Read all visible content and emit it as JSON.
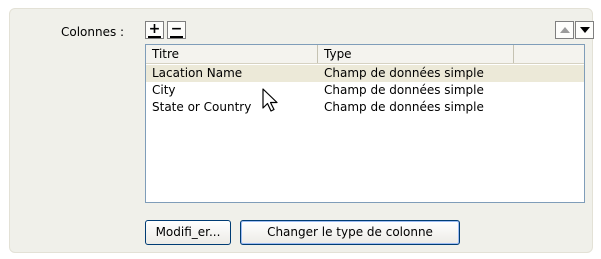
{
  "columns_label": "Colonnes :",
  "toolbar": {
    "add_label": "+",
    "remove_label": "−"
  },
  "table": {
    "headers": [
      "Titre",
      "Type",
      ""
    ],
    "rows": [
      {
        "title": "Lacation Name",
        "type": "Champ de données simple",
        "selected": true
      },
      {
        "title": "City",
        "type": "Champ de données simple",
        "selected": false
      },
      {
        "title": "State or Country",
        "type": "Champ de données simple",
        "selected": false
      }
    ]
  },
  "buttons": {
    "modify_label": "Modifi_er...",
    "change_type_label": "Changer le type de colonne"
  },
  "icons": {
    "move_up": "arrow-up-icon",
    "move_down": "arrow-down-icon",
    "cursor": "mouse-pointer-icon"
  },
  "colors": {
    "panel_bg": "#f0f0ea",
    "selected_row": "#ece9d8",
    "button_border": "#003c74"
  }
}
